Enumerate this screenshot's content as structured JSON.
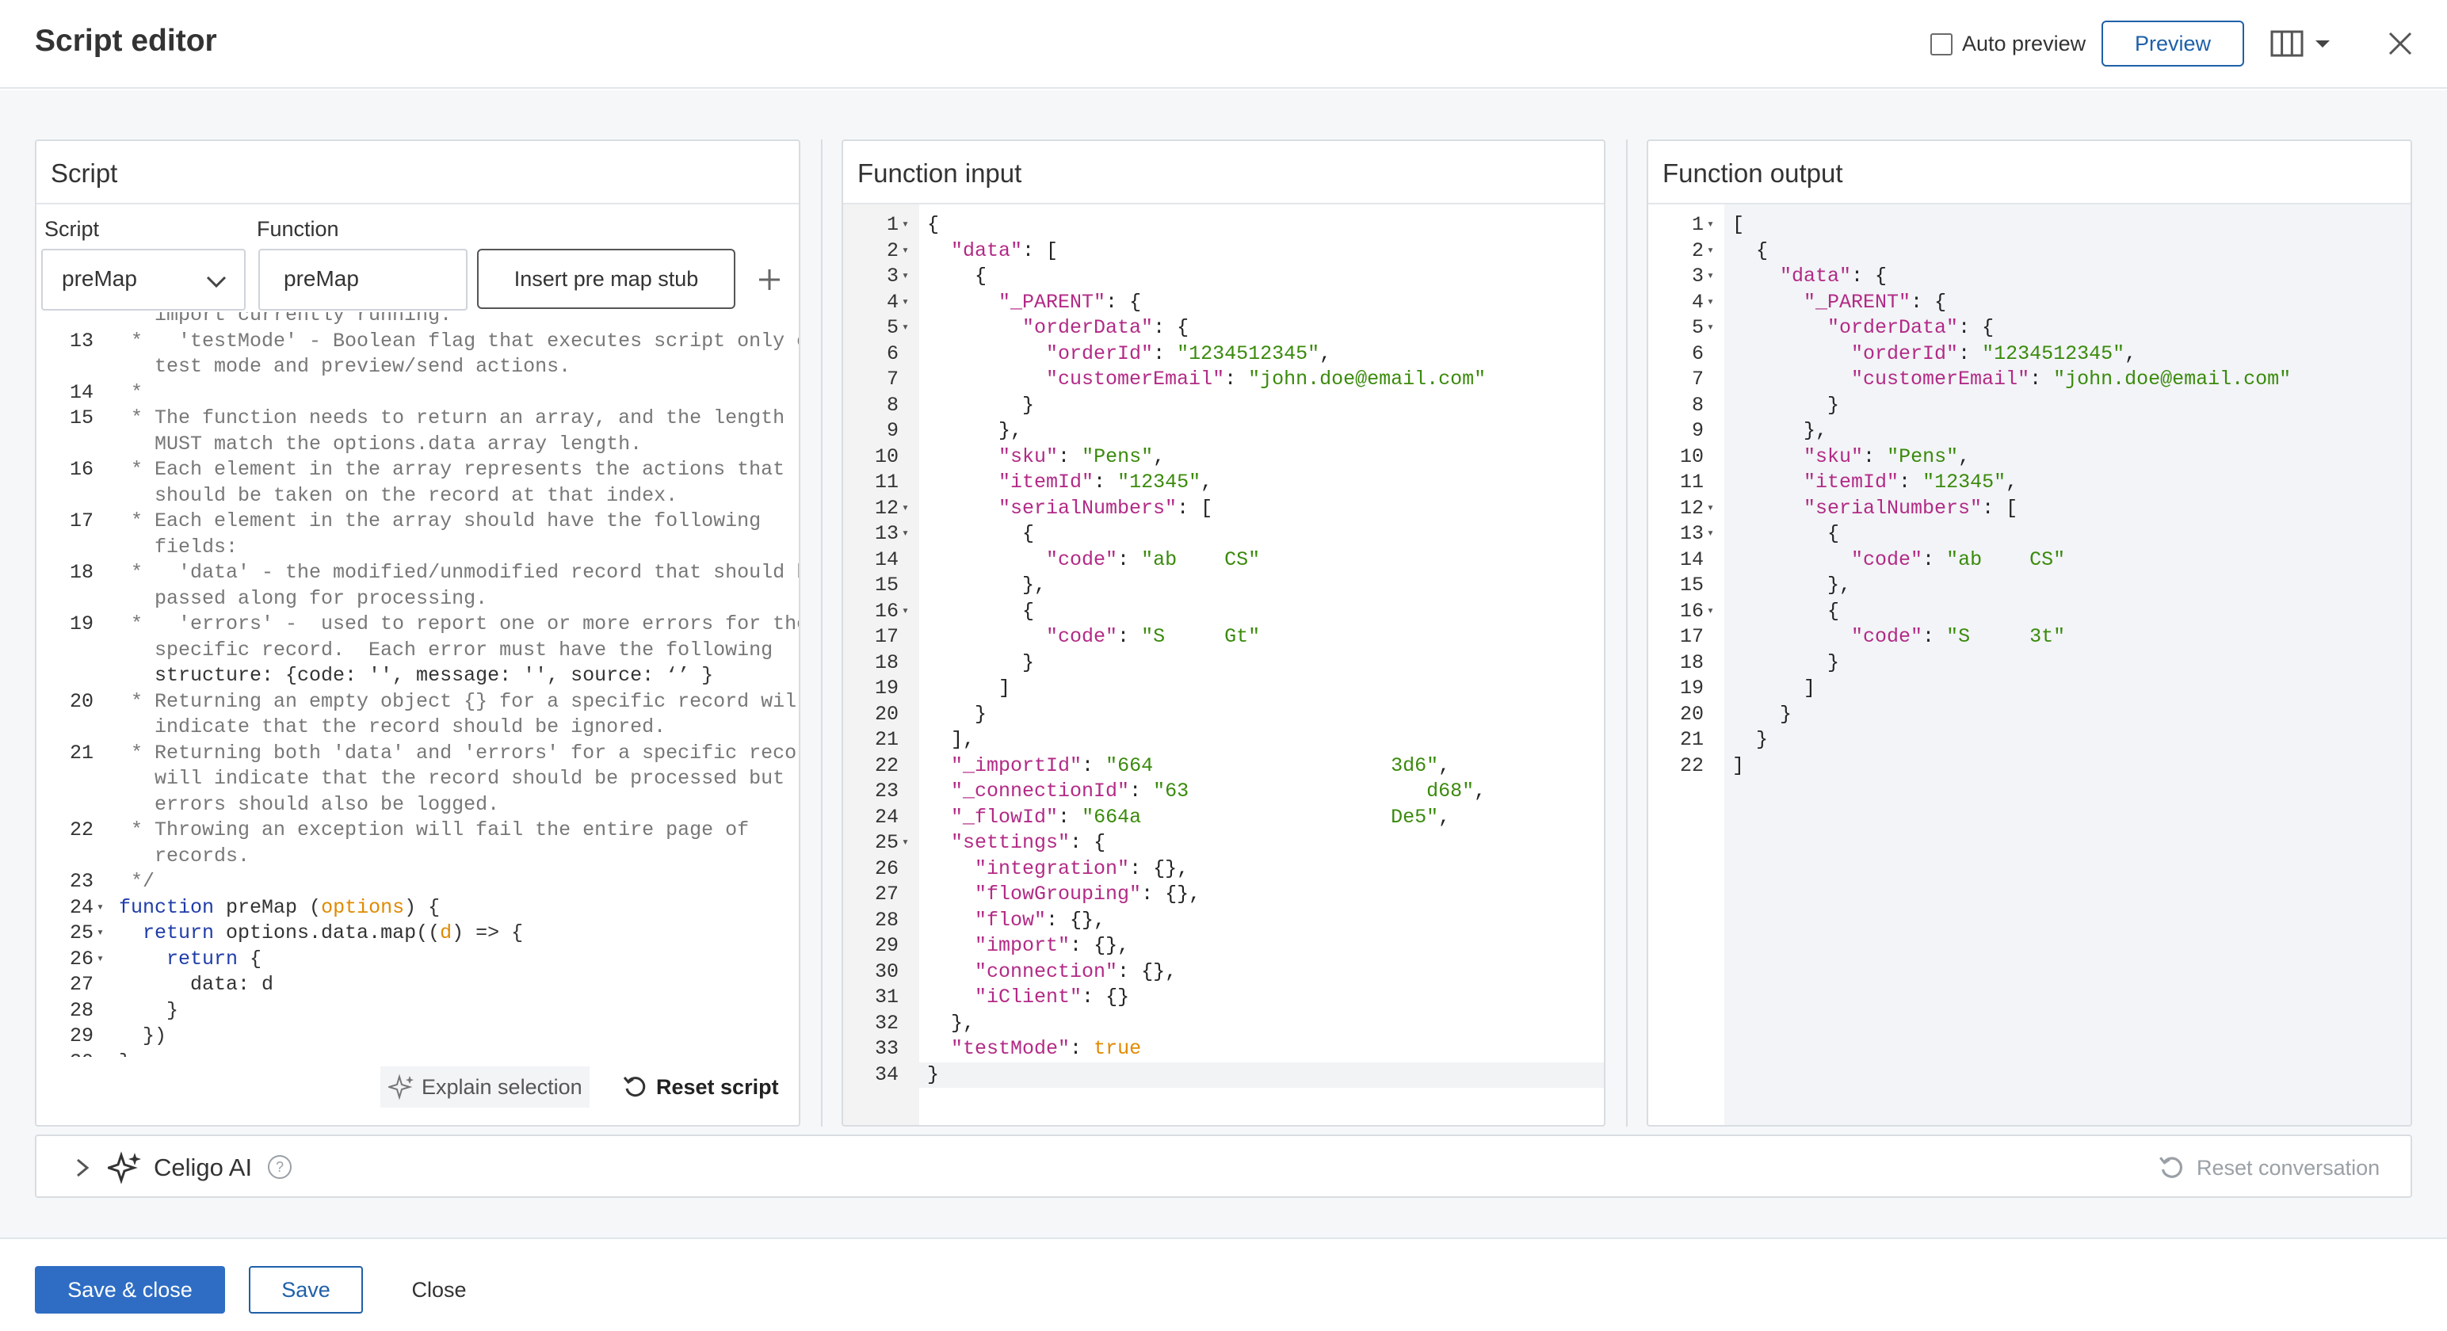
{
  "header": {
    "title": "Script editor",
    "auto_preview_label": "Auto preview",
    "preview_label": "Preview"
  },
  "script_panel": {
    "title": "Script",
    "script_label": "Script",
    "function_label": "Function",
    "script_value": "preMap",
    "function_value": "preMap",
    "insert_stub_label": "Insert pre map stub",
    "explain_label": "Explain selection",
    "reset_label": "Reset script",
    "lines": [
      {
        "n": "",
        "f": false,
        "t": "   import currently running."
      },
      {
        "n": "13",
        "f": false,
        "t": " *   'testMode' - Boolean flag that executes script only on"
      },
      {
        "n": "",
        "f": false,
        "t": "   test mode and preview/send actions."
      },
      {
        "n": "14",
        "f": false,
        "t": " *"
      },
      {
        "n": "15",
        "f": false,
        "t": " * The function needs to return an array, and the length"
      },
      {
        "n": "",
        "f": false,
        "t": "   MUST match the options.data array length."
      },
      {
        "n": "16",
        "f": false,
        "t": " * Each element in the array represents the actions that"
      },
      {
        "n": "",
        "f": false,
        "t": "   should be taken on the record at that index."
      },
      {
        "n": "17",
        "f": false,
        "t": " * Each element in the array should have the following"
      },
      {
        "n": "",
        "f": false,
        "t": "   fields:"
      },
      {
        "n": "18",
        "f": false,
        "t": " *   'data' - the modified/unmodified record that should be"
      },
      {
        "n": "",
        "f": false,
        "t": "   passed along for processing."
      },
      {
        "n": "19",
        "f": false,
        "t": " *   'errors' -  used to report one or more errors for the"
      },
      {
        "n": "",
        "f": false,
        "t": "   specific record.  Each error must have the following"
      },
      {
        "n": "",
        "f": false,
        "t": "   structure: {code: '', message: '', source: ‘’ }"
      },
      {
        "n": "20",
        "f": false,
        "t": " * Returning an empty object {} for a specific record will"
      },
      {
        "n": "",
        "f": false,
        "t": "   indicate that the record should be ignored."
      },
      {
        "n": "21",
        "f": false,
        "t": " * Returning both 'data' and 'errors' for a specific record"
      },
      {
        "n": "",
        "f": false,
        "t": "   will indicate that the record should be processed but"
      },
      {
        "n": "",
        "f": false,
        "t": "   errors should also be logged."
      },
      {
        "n": "22",
        "f": false,
        "t": " * Throwing an exception will fail the entire page of"
      },
      {
        "n": "",
        "f": false,
        "t": "   records."
      },
      {
        "n": "23",
        "f": false,
        "t": " */"
      },
      {
        "n": "24",
        "f": true,
        "t": "function preMap (options) {"
      },
      {
        "n": "25",
        "f": true,
        "t": "  return options.data.map((d) => {"
      },
      {
        "n": "26",
        "f": true,
        "t": "    return {"
      },
      {
        "n": "27",
        "f": false,
        "t": "      data: d"
      },
      {
        "n": "28",
        "f": false,
        "t": "    }"
      },
      {
        "n": "29",
        "f": false,
        "t": "  })"
      },
      {
        "n": "30",
        "f": false,
        "t": "}"
      }
    ]
  },
  "input_panel": {
    "title": "Function input",
    "lines": [
      {
        "n": "1",
        "f": true,
        "t": "{"
      },
      {
        "n": "2",
        "f": true,
        "t": "  \"data\": ["
      },
      {
        "n": "3",
        "f": true,
        "t": "    {"
      },
      {
        "n": "4",
        "f": true,
        "t": "      \"_PARENT\": {"
      },
      {
        "n": "5",
        "f": true,
        "t": "        \"orderData\": {"
      },
      {
        "n": "6",
        "f": false,
        "t": "          \"orderId\": \"1234512345\","
      },
      {
        "n": "7",
        "f": false,
        "t": "          \"customerEmail\": \"john.doe@email.com\""
      },
      {
        "n": "8",
        "f": false,
        "t": "        }"
      },
      {
        "n": "9",
        "f": false,
        "t": "      },"
      },
      {
        "n": "10",
        "f": false,
        "t": "      \"sku\": \"Pens\","
      },
      {
        "n": "11",
        "f": false,
        "t": "      \"itemId\": \"12345\","
      },
      {
        "n": "12",
        "f": true,
        "t": "      \"serialNumbers\": ["
      },
      {
        "n": "13",
        "f": true,
        "t": "        {"
      },
      {
        "n": "14",
        "f": false,
        "t": "          \"code\": \"ab    CS\""
      },
      {
        "n": "15",
        "f": false,
        "t": "        },"
      },
      {
        "n": "16",
        "f": true,
        "t": "        {"
      },
      {
        "n": "17",
        "f": false,
        "t": "          \"code\": \"S     Gt\""
      },
      {
        "n": "18",
        "f": false,
        "t": "        }"
      },
      {
        "n": "19",
        "f": false,
        "t": "      ]"
      },
      {
        "n": "20",
        "f": false,
        "t": "    }"
      },
      {
        "n": "21",
        "f": false,
        "t": "  ],"
      },
      {
        "n": "22",
        "f": false,
        "t": "  \"_importId\": \"664                    3d6\","
      },
      {
        "n": "23",
        "f": false,
        "t": "  \"_connectionId\": \"63                    d68\","
      },
      {
        "n": "24",
        "f": false,
        "t": "  \"_flowId\": \"664a                     De5\","
      },
      {
        "n": "25",
        "f": true,
        "t": "  \"settings\": {"
      },
      {
        "n": "26",
        "f": false,
        "t": "    \"integration\": {},"
      },
      {
        "n": "27",
        "f": false,
        "t": "    \"flowGrouping\": {},"
      },
      {
        "n": "28",
        "f": false,
        "t": "    \"flow\": {},"
      },
      {
        "n": "29",
        "f": false,
        "t": "    \"import\": {},"
      },
      {
        "n": "30",
        "f": false,
        "t": "    \"connection\": {},"
      },
      {
        "n": "31",
        "f": false,
        "t": "    \"iClient\": {}"
      },
      {
        "n": "32",
        "f": false,
        "t": "  },"
      },
      {
        "n": "33",
        "f": false,
        "t": "  \"testMode\": true"
      },
      {
        "n": "34",
        "f": false,
        "t": "}"
      }
    ]
  },
  "output_panel": {
    "title": "Function output",
    "lines": [
      {
        "n": "1",
        "f": true,
        "t": "["
      },
      {
        "n": "2",
        "f": true,
        "t": "  {"
      },
      {
        "n": "3",
        "f": true,
        "t": "    \"data\": {"
      },
      {
        "n": "4",
        "f": true,
        "t": "      \"_PARENT\": {"
      },
      {
        "n": "5",
        "f": true,
        "t": "        \"orderData\": {"
      },
      {
        "n": "6",
        "f": false,
        "t": "          \"orderId\": \"1234512345\","
      },
      {
        "n": "7",
        "f": false,
        "t": "          \"customerEmail\": \"john.doe@email.com\""
      },
      {
        "n": "8",
        "f": false,
        "t": "        }"
      },
      {
        "n": "9",
        "f": false,
        "t": "      },"
      },
      {
        "n": "10",
        "f": false,
        "t": "      \"sku\": \"Pens\","
      },
      {
        "n": "11",
        "f": false,
        "t": "      \"itemId\": \"12345\","
      },
      {
        "n": "12",
        "f": true,
        "t": "      \"serialNumbers\": ["
      },
      {
        "n": "13",
        "f": true,
        "t": "        {"
      },
      {
        "n": "14",
        "f": false,
        "t": "          \"code\": \"ab    CS\""
      },
      {
        "n": "15",
        "f": false,
        "t": "        },"
      },
      {
        "n": "16",
        "f": true,
        "t": "        {"
      },
      {
        "n": "17",
        "f": false,
        "t": "          \"code\": \"S     3t\""
      },
      {
        "n": "18",
        "f": false,
        "t": "        }"
      },
      {
        "n": "19",
        "f": false,
        "t": "      ]"
      },
      {
        "n": "20",
        "f": false,
        "t": "    }"
      },
      {
        "n": "21",
        "f": false,
        "t": "  }"
      },
      {
        "n": "22",
        "f": false,
        "t": "]"
      }
    ]
  },
  "ai": {
    "label": "Celigo AI",
    "help": "?",
    "reset_label": "Reset conversation"
  },
  "footer": {
    "save_close_label": "Save & close",
    "save_label": "Save",
    "close_label": "Close"
  },
  "colors": {
    "primary": "#2f6dc4",
    "json_key": "#b22a86",
    "json_string": "#3a8a0c",
    "json_bool": "#e08a00",
    "js_keyword": "#1f3ca8",
    "comment": "#777777"
  }
}
